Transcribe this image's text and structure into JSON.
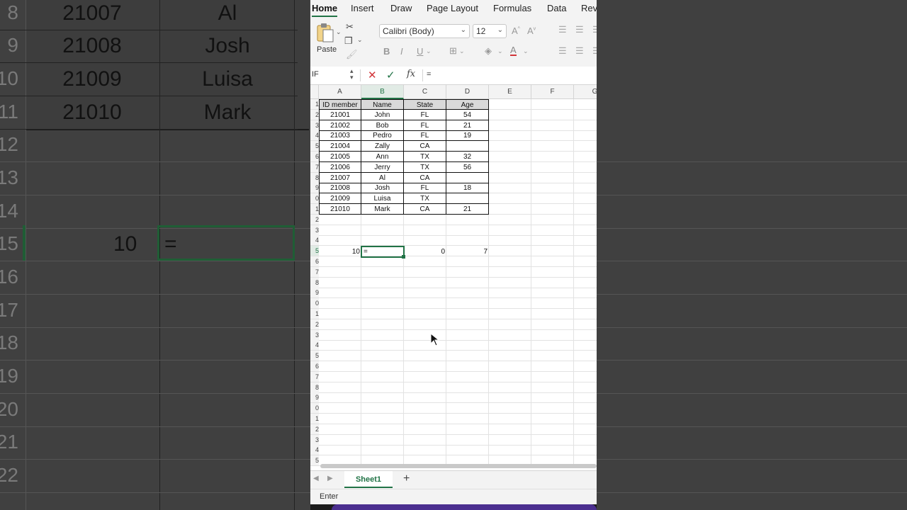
{
  "background_zoom": {
    "rows": [
      {
        "num": "8",
        "id": "21007",
        "name": "Al"
      },
      {
        "num": "9",
        "id": "21008",
        "name": "Josh"
      },
      {
        "num": "10",
        "id": "21009",
        "name": "Luisa"
      },
      {
        "num": "11",
        "id": "21010",
        "name": "Mark"
      }
    ],
    "empty_rows": [
      "12",
      "13",
      "14",
      "15",
      "16",
      "17",
      "18",
      "19",
      "20",
      "21",
      "22"
    ],
    "selected_value": "10",
    "selected_formula": "="
  },
  "ribbon": {
    "tabs": [
      "Home",
      "Insert",
      "Draw",
      "Page Layout",
      "Formulas",
      "Data",
      "Rev"
    ],
    "active_tab": "Home",
    "paste_label": "Paste",
    "font_name": "Calibri (Body)",
    "font_size": "12",
    "bold": "B",
    "italic": "I",
    "underline": "U"
  },
  "formula_bar": {
    "name_box": "IF",
    "fx": "fx",
    "content": "="
  },
  "grid": {
    "columns": [
      "A",
      "B",
      "C",
      "D",
      "E",
      "F",
      "G"
    ],
    "selected_column": "B",
    "header": [
      "ID member",
      "Name",
      "State",
      "Age"
    ],
    "rows": [
      {
        "id": "21001",
        "name": "John",
        "state": "FL",
        "age": "54"
      },
      {
        "id": "21002",
        "name": "Bob",
        "state": "FL",
        "age": "21"
      },
      {
        "id": "21003",
        "name": "Pedro",
        "state": "FL",
        "age": "19"
      },
      {
        "id": "21004",
        "name": "Zally",
        "state": "CA",
        "age": ""
      },
      {
        "id": "21005",
        "name": "Ann",
        "state": "TX",
        "age": "32"
      },
      {
        "id": "21006",
        "name": "Jerry",
        "state": "TX",
        "age": "56"
      },
      {
        "id": "21007",
        "name": "Al",
        "state": "CA",
        "age": ""
      },
      {
        "id": "21008",
        "name": "Josh",
        "state": "FL",
        "age": "18"
      },
      {
        "id": "21009",
        "name": "Luisa",
        "state": "TX",
        "age": ""
      },
      {
        "id": "21010",
        "name": "Mark",
        "state": "CA",
        "age": "21"
      }
    ],
    "row15": {
      "a": "10",
      "b": "=",
      "c": "0",
      "d": "7"
    },
    "row_numbers": [
      "1",
      "2",
      "3",
      "4",
      "5",
      "6",
      "7",
      "8",
      "9",
      "0",
      "1",
      "2",
      "3",
      "4",
      "5",
      "6",
      "7",
      "8",
      "9",
      "0",
      "1",
      "2",
      "3",
      "4",
      "5",
      "6",
      "7",
      "8",
      "9",
      "0",
      "1",
      "2",
      "3",
      "4",
      "5"
    ]
  },
  "sheet_tabs": {
    "active": "Sheet1",
    "add": "+"
  },
  "status": {
    "mode": "Enter"
  },
  "colors": {
    "accent": "#217346",
    "header_fill": "#d9d9d9",
    "cancel": "#d13438"
  }
}
